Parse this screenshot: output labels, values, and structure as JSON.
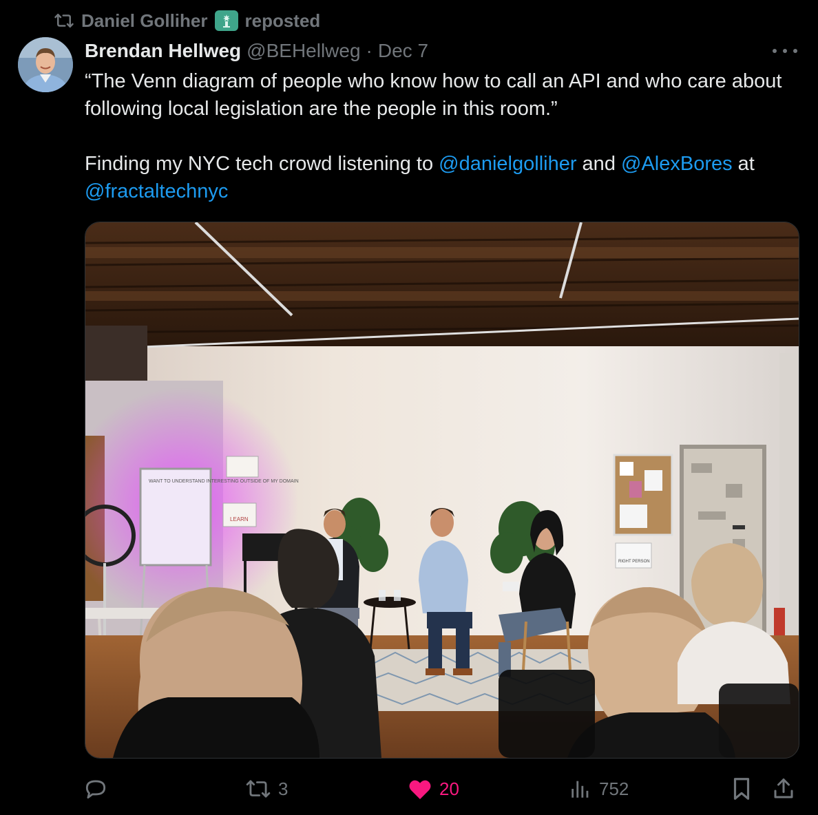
{
  "repost": {
    "user": "Daniel Golliher",
    "label": "reposted",
    "icon": "repost-icon",
    "badge_icon": "statue-of-liberty-icon"
  },
  "author": {
    "name": "Brendan Hellweg",
    "handle": "@BEHellweg",
    "separator": "·",
    "date": "Dec 7"
  },
  "content": {
    "line1": "“The Venn diagram of people who know how to call an API and who care about following local legislation are the people in this room.”",
    "line2_a": "Finding my NYC tech crowd listening to ",
    "mention1": "@danielgolliher",
    "line2_b": " and ",
    "mention2": "@AlexBores",
    "line2_c": " at ",
    "mention3": "@fractaltechnyc"
  },
  "media": {
    "signs": {
      "whiteboard": "WANT TO UNDERSTAND INTERESTING OUTSIDE OF MY DOMAIN",
      "learn": "LEARN",
      "right_person": "RIGHT PERSON"
    }
  },
  "actions": {
    "reply": {
      "icon": "reply-icon",
      "count": ""
    },
    "repost": {
      "icon": "repost-icon",
      "count": "3"
    },
    "like": {
      "icon": "heart-icon",
      "count": "20",
      "color": "#f91880"
    },
    "views": {
      "icon": "views-icon",
      "count": "752"
    },
    "bookmark": {
      "icon": "bookmark-icon"
    },
    "share": {
      "icon": "share-icon"
    }
  },
  "colors": {
    "background": "#000000",
    "text": "#e7e9ea",
    "muted": "#71767b",
    "link": "#1d9bf0",
    "like": "#f91880"
  }
}
